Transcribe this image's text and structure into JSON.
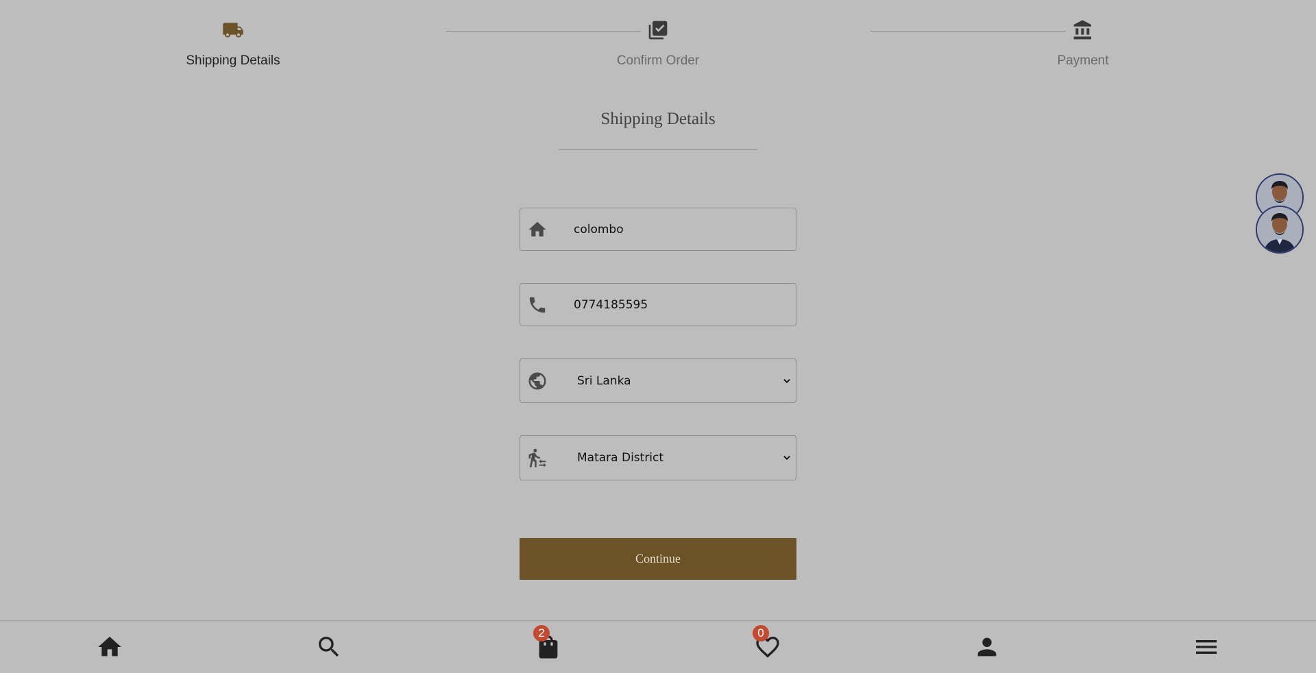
{
  "stepper": {
    "steps": [
      {
        "label": "Shipping Details",
        "icon": "truck-icon",
        "state": "active"
      },
      {
        "label": "Confirm Order",
        "icon": "library-add-check-icon",
        "state": "inactive"
      },
      {
        "label": "Payment",
        "icon": "bank-icon",
        "state": "inactive"
      }
    ]
  },
  "form": {
    "title": "Shipping Details",
    "address": {
      "value": "colombo",
      "icon": "home-icon"
    },
    "phone": {
      "value": "0774185595",
      "icon": "phone-icon"
    },
    "country": {
      "value": "Sri Lanka",
      "icon": "globe-icon"
    },
    "district": {
      "value": "Matara District",
      "icon": "transfer-within-station-icon"
    },
    "continue_label": "Continue"
  },
  "bottom_nav": {
    "cart_count": "2",
    "wishlist_count": "0"
  },
  "colors": {
    "background": "#bdbdbd",
    "accent": "#6b5227",
    "badge": "#c24a30"
  }
}
